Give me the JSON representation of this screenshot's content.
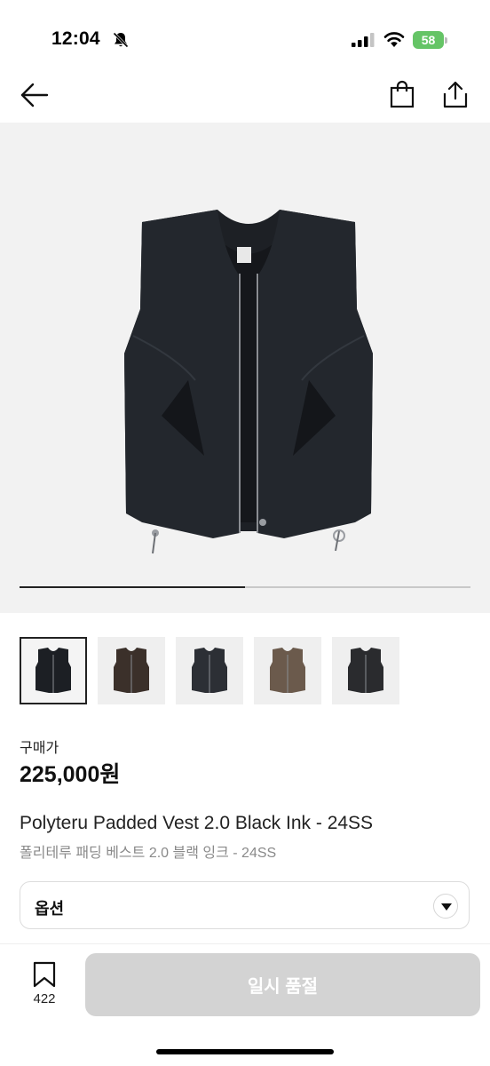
{
  "status_bar": {
    "time": "12:04",
    "battery_level": "58",
    "icons": [
      "bell-slash-icon",
      "cellular-signal-icon",
      "wifi-icon",
      "battery-icon"
    ]
  },
  "nav": {
    "icons": [
      "back-arrow-icon",
      "shopping-bag-icon",
      "share-icon"
    ]
  },
  "gallery": {
    "progress_fraction": 0.5,
    "thumbnails": [
      {
        "name": "vest-black",
        "color": "#1c1f24",
        "selected": true
      },
      {
        "name": "vest-brown",
        "color": "#3b302a",
        "selected": false
      },
      {
        "name": "vest-charcoal",
        "color": "#2c2f35",
        "selected": false
      },
      {
        "name": "vest-olive-brown",
        "color": "#6b5a4c",
        "selected": false
      },
      {
        "name": "vest-dark-gray",
        "color": "#2a2b2e",
        "selected": false
      }
    ]
  },
  "product": {
    "price_label": "구매가",
    "price": "225,000원",
    "title_en": "Polyteru Padded Vest 2.0 Black Ink - 24SS",
    "title_ko": "폴리테루 패딩 베스트 2.0 블랙 잉크 - 24SS"
  },
  "option": {
    "label": "옵션"
  },
  "bottom_bar": {
    "wishlist_count": "422",
    "buy_label": "일시 품절"
  },
  "colors": {
    "accent_disabled": "#d3d3d3",
    "battery_green": "#65c466"
  }
}
